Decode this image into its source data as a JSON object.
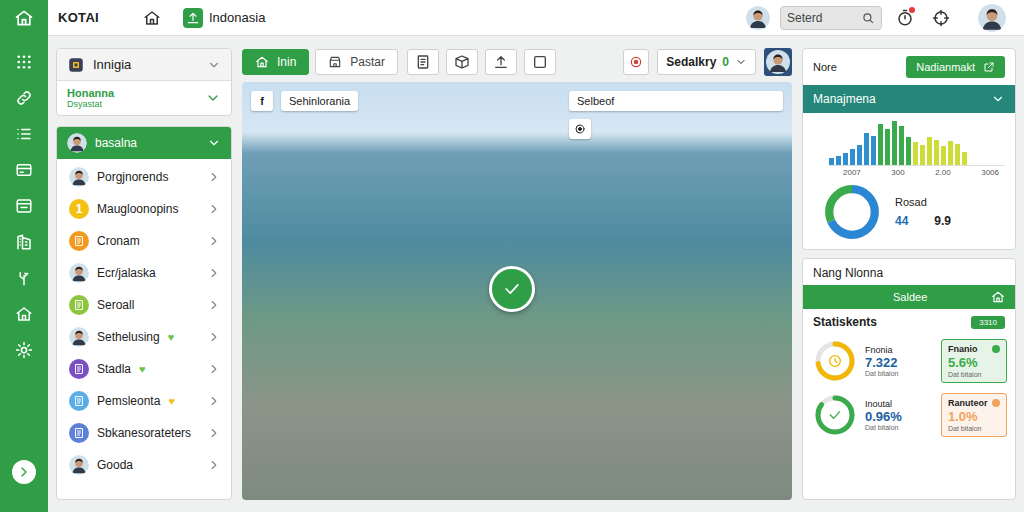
{
  "topbar": {
    "brand": "KOTAI",
    "location": "Indonasia",
    "search": {
      "value": "Seterd"
    },
    "alert_dot": true
  },
  "left_panel": {
    "region_card": {
      "title": "Innigia",
      "expanded": false,
      "sub_title": "Honanna",
      "sub_caption": "Dsyastat",
      "sub_expanded": false
    },
    "list_card": {
      "title": "basalna",
      "expanded": true,
      "items": [
        {
          "label": "Porgjnorends",
          "kind": "avatar",
          "expanded": false
        },
        {
          "label": "Maugloonopins",
          "kind": "badge",
          "badge": "1",
          "color": "#f2c114",
          "expanded": false
        },
        {
          "label": "Cronam",
          "kind": "icon",
          "color": "#f39a1e",
          "expanded": false
        },
        {
          "label": "Ecr/jalaska",
          "kind": "avatar",
          "expanded": false
        },
        {
          "label": "Seroall",
          "kind": "icon",
          "color": "#8cc63f",
          "expanded": false
        },
        {
          "label": "Sethelusing",
          "kind": "avatar",
          "mark": "♥",
          "mark_color": "#6cc24a",
          "expanded": false
        },
        {
          "label": "Stadla",
          "kind": "icon",
          "color": "#7a4fc2",
          "mark": "♥",
          "mark_color": "#6cc24a",
          "expanded": false
        },
        {
          "label": "Pemsleonta",
          "kind": "icon",
          "color": "#5aaee8",
          "mark": "♥",
          "mark_color": "#f2c114",
          "expanded": false
        },
        {
          "label": "Sbkanesorateters",
          "kind": "icon",
          "color": "#5d80d8",
          "expanded": false
        },
        {
          "label": "Gooda",
          "kind": "avatar",
          "expanded": false
        }
      ]
    }
  },
  "toolbar": {
    "tabs": [
      {
        "label": "Inin",
        "selected": true
      },
      {
        "label": "Pastar",
        "selected": false
      }
    ],
    "dropdown": {
      "value": "Sedalkry",
      "badge": "0",
      "expanded": false
    }
  },
  "map": {
    "corner_button": "f",
    "place_label": "Sehinlorania",
    "view_label": "Selbeof"
  },
  "right_panel": {
    "summary_card": {
      "label": "Nore",
      "button": "Nadianmakt",
      "section_title": "Manajmena",
      "section_expanded": false,
      "chart": {
        "series": [
          {
            "color": "#2f8fd0",
            "values": [
              10,
              14,
              18,
              24,
              30,
              48,
              44
            ]
          },
          {
            "color": "#3aaa4a",
            "values": [
              62,
              54,
              66,
              58,
              42
            ]
          },
          {
            "color": "#cddc39",
            "values": [
              34,
              30,
              42,
              38,
              28,
              36,
              32,
              20
            ]
          }
        ],
        "ticks": [
          "2007",
          "300",
          "2.00",
          "3006"
        ]
      },
      "donut": {
        "segments": [
          {
            "value": 68,
            "color": "#2b87d1"
          },
          {
            "value": 32,
            "color": "#3aaa4a"
          }
        ]
      },
      "stat_label": "Rosad",
      "stats": [
        "44",
        "9.9"
      ]
    },
    "stats_card": {
      "title": "Nang Nlonna",
      "bar_label": "Saldee",
      "section_title": "Statiskents",
      "section_badge": "3310",
      "rows": [
        {
          "kind": "clock",
          "name": "Fnonia",
          "value": "7.322",
          "caption": "Dat bitalon",
          "level": 0.72,
          "color": "#f2b705",
          "box": {
            "title": "Fnanio",
            "value": "5.6%",
            "caption": "Dat bitalon",
            "color": "#3aaa4a"
          }
        },
        {
          "kind": "check",
          "name": "Inoutal",
          "value": "0.96%",
          "caption": "Dat bitalon",
          "level": 0.85,
          "color": "#3aaa4a",
          "box": {
            "title": "Ranuteor",
            "value": "1.0%",
            "caption": "Dat bitalon",
            "color": "#f0a35e"
          }
        }
      ]
    }
  }
}
